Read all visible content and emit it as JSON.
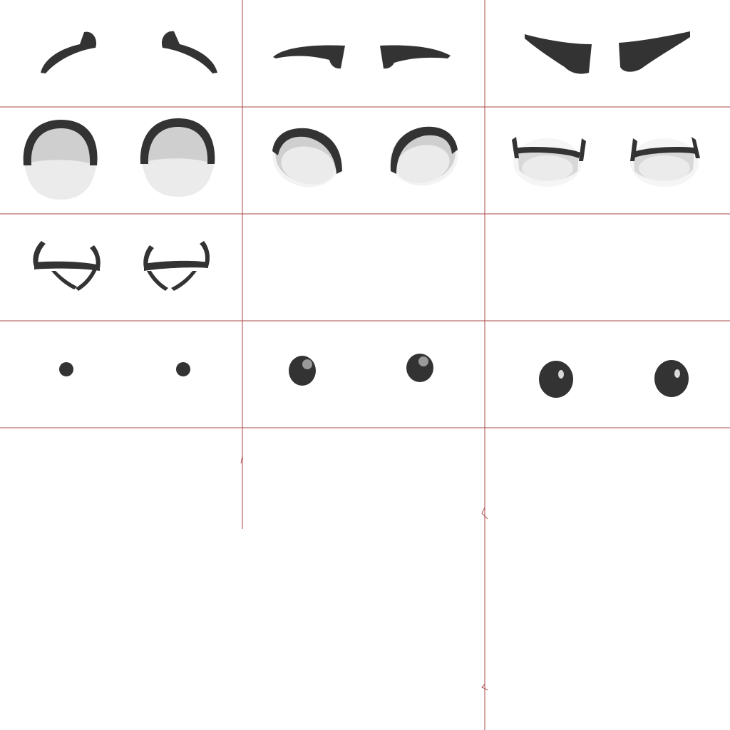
{
  "sheet": {
    "background_color": "#ffffff",
    "grid_line_color": "#9b2a2a",
    "ink_color": "#333333",
    "eye_shade_color": "#cfcfcf",
    "eye_white_color": "#ececec",
    "highlight_color": "#9a9a9a"
  },
  "sprites": [
    {
      "group": "eyebrows",
      "name": "eyebrows-raised-arched"
    },
    {
      "group": "eyebrows",
      "name": "eyebrows-flat-neutral"
    },
    {
      "group": "eyebrows",
      "name": "eyebrows-angry-slanted"
    },
    {
      "group": "eye-sockets",
      "name": "eye-sockets-wide-open"
    },
    {
      "group": "eye-sockets",
      "name": "eye-sockets-tilted-open"
    },
    {
      "group": "eye-sockets",
      "name": "eye-sockets-half-closed"
    },
    {
      "group": "eye-sockets",
      "name": "eye-sockets-closed"
    },
    {
      "group": "pupils",
      "name": "pupils-small-dot"
    },
    {
      "group": "pupils",
      "name": "pupils-medium-highlight"
    },
    {
      "group": "pupils",
      "name": "pupils-large-highlight"
    }
  ]
}
